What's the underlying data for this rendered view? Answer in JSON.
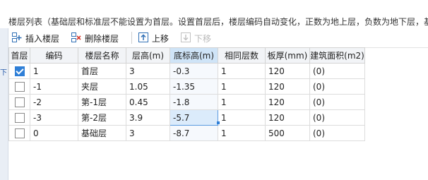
{
  "info_text": "楼层列表（基础层和标准层不能设置为首层。设置首层后，楼层编码自动变化，正数为地上层，负数为地下层，基",
  "side_marker": "下",
  "toolbar": {
    "insert_label": "插入楼层",
    "delete_label": "删除楼层",
    "up_label": "上移",
    "down_label": "下移"
  },
  "columns": [
    "首层",
    "编码",
    "楼层名称",
    "层高(m)",
    "底标高(m)",
    "相同层数",
    "板厚(mm)",
    "建筑面积(m2)"
  ],
  "rows": [
    {
      "first": true,
      "code": "1",
      "name": "首层",
      "height": "3",
      "bottom": "-0.3",
      "same": "1",
      "slab": "120",
      "area": "(0)"
    },
    {
      "first": false,
      "code": "-1",
      "name": "夹层",
      "height": "1.05",
      "bottom": "-1.35",
      "same": "1",
      "slab": "120",
      "area": "(0)"
    },
    {
      "first": false,
      "code": "-2",
      "name": "第-1层",
      "height": "0.45",
      "bottom": "-1.8",
      "same": "1",
      "slab": "120",
      "area": "(0)"
    },
    {
      "first": false,
      "code": "-3",
      "name": "第-2层",
      "height": "3.9",
      "bottom": "-5.7",
      "same": "1",
      "slab": "120",
      "area": "(0)"
    },
    {
      "first": false,
      "code": "0",
      "name": "基础层",
      "height": "3",
      "bottom": "-8.7",
      "same": "1",
      "slab": "500",
      "area": "(0)"
    }
  ],
  "selected_row": 3,
  "highlight_column": 4,
  "colors": {
    "accent": "#2f7fd7",
    "header_highlight": "#cfe4f7",
    "disabled": "#b9b9b9"
  }
}
